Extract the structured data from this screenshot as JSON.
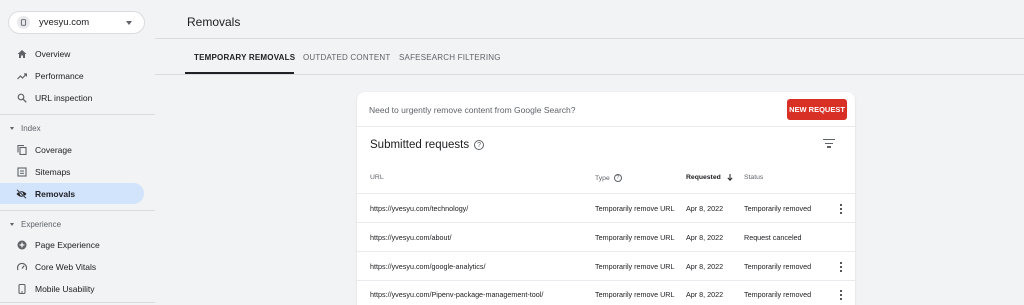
{
  "sidebar": {
    "property_label": "yvesyu.com",
    "items": [
      {
        "label": "Overview",
        "icon": "home-icon"
      },
      {
        "label": "Performance",
        "icon": "trending-up-icon"
      },
      {
        "label": "URL inspection",
        "icon": "search-icon"
      }
    ],
    "index_section": {
      "label": "Index",
      "items": [
        {
          "label": "Coverage",
          "icon": "file-copy-icon"
        },
        {
          "label": "Sitemaps",
          "icon": "sitemap-icon"
        },
        {
          "label": "Removals",
          "icon": "visibility-off-icon",
          "active": true
        }
      ]
    },
    "experience_section": {
      "label": "Experience",
      "items": [
        {
          "label": "Page Experience",
          "icon": "add-circle-icon"
        },
        {
          "label": "Core Web Vitals",
          "icon": "speed-icon"
        },
        {
          "label": "Mobile Usability",
          "icon": "phone-icon"
        }
      ]
    }
  },
  "main": {
    "title": "Removals",
    "tabs": [
      {
        "label": "TEMPORARY REMOVALS",
        "active": true
      },
      {
        "label": "OUTDATED CONTENT"
      },
      {
        "label": "SAFESEARCH FILTERING"
      }
    ],
    "banner_text": "Need to urgently remove content from Google Search?",
    "new_request_label": "NEW REQUEST",
    "submitted_title": "Submitted requests",
    "columns": {
      "url": "URL",
      "type": "Type",
      "requested": "Requested",
      "status": "Status"
    },
    "rows": [
      {
        "url": "https://yvesyu.com/technology/",
        "type": "Temporarily remove URL",
        "requested": "Apr 8, 2022",
        "status": "Temporarily removed",
        "menu": true
      },
      {
        "url": "https://yvesyu.com/about/",
        "type": "Temporarily remove URL",
        "requested": "Apr 8, 2022",
        "status": "Request canceled",
        "menu": false
      },
      {
        "url": "https://yvesyu.com/google-analytics/",
        "type": "Temporarily remove URL",
        "requested": "Apr 8, 2022",
        "status": "Temporarily removed",
        "menu": true
      },
      {
        "url": "https://yvesyu.com/Pipenv-package-management-tool/",
        "type": "Temporarily remove URL",
        "requested": "Apr 8, 2022",
        "status": "Temporarily removed",
        "menu": true
      }
    ]
  },
  "colors": {
    "accent_red": "#d93025",
    "active_nav": "#d2e3fc",
    "background": "#f1f3f4"
  }
}
